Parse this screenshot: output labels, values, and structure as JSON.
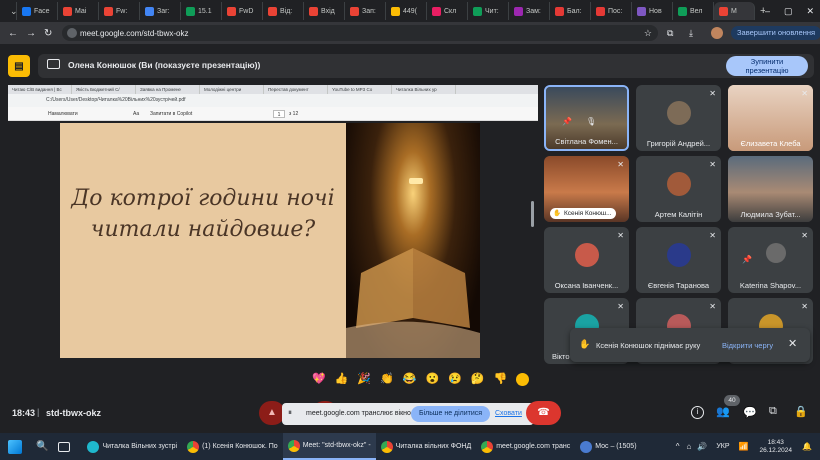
{
  "tabs": [
    {
      "label": "Face",
      "color": "#1877f2"
    },
    {
      "label": "Mai",
      "color": "#ea4335"
    },
    {
      "label": "Fw:",
      "color": "#ea4335"
    },
    {
      "label": "Заг:",
      "color": "#4285f4"
    },
    {
      "label": "15.1",
      "color": "#0f9d58"
    },
    {
      "label": "FwD",
      "color": "#ea4335"
    },
    {
      "label": "Від:",
      "color": "#ea4335"
    },
    {
      "label": "Вхід",
      "color": "#ea4335"
    },
    {
      "label": "Зап:",
      "color": "#ea4335"
    },
    {
      "label": "449(",
      "color": "#fbbc04"
    },
    {
      "label": "Скл",
      "color": "#e91e63"
    },
    {
      "label": "Чит:",
      "color": "#0f9d58"
    },
    {
      "label": "Зам:",
      "color": "#9c27b0"
    },
    {
      "label": "Бал:",
      "color": "#e53935"
    },
    {
      "label": "Пос:",
      "color": "#e53935"
    },
    {
      "label": "Нов",
      "color": "#7e57c2"
    },
    {
      "label": "Вел",
      "color": "#0f9d58"
    },
    {
      "label": "M",
      "color": "#ea4335"
    }
  ],
  "new_tab": "+",
  "window_controls": [
    "–",
    "▢",
    "✕"
  ],
  "address": "meet.google.com/std-tbwx-okz",
  "update_button": "Завершити оновлення",
  "meet": {
    "presenter_text": "Олена Конюшок (Ви (показуєте презентацію))",
    "stop_button_line1": "Зупинити",
    "stop_button_line2": "презентацію",
    "meeting_code": "std-tbwx-okz",
    "time": "18:43",
    "participants_count": "40"
  },
  "shared": {
    "tabs": [
      "Читаю С/В видання | Вс",
      "Якість Бюджетний С/",
      "Заявка на Промене",
      "Молодіжні центри",
      "Перестав документ",
      "YouTube to MP3 Co",
      "Читалка Вільних ур"
    ],
    "address": "C:/Users/User/Desktop/Читалка%20Вільних%20зустрічей.pdf",
    "pdf_toolbar": [
      "Намалювати",
      "Aa",
      "Запитати в Copilot"
    ],
    "page": "1",
    "page_total": "з 12",
    "slide_title": "До котрої години ночі читали найдовше?"
  },
  "tiles": [
    {
      "name": "Світлана Фомен...",
      "muted": false
    },
    {
      "name": "Григорій Андрей...",
      "muted": true
    },
    {
      "name": "Єлизавета Клеба",
      "muted": true
    },
    {
      "name": "Ксенія Конюш...",
      "muted": true
    },
    {
      "name": "Артем Калітін",
      "muted": true
    },
    {
      "name": "Людмила Зубат...",
      "muted": true
    },
    {
      "name": "Оксана Іванченк...",
      "muted": true
    },
    {
      "name": "Євгенія Таранова",
      "muted": true
    },
    {
      "name": "Katerina Shapov...",
      "muted": true
    },
    {
      "name": "Вікто",
      "muted": true
    }
  ],
  "hand_notice": {
    "text": "Ксенія Конюшок піднімає руку",
    "link": "Відкрити чергу"
  },
  "reactions": [
    "💖",
    "👍",
    "🎉",
    "👏",
    "😂",
    "😮",
    "😢",
    "🤔",
    "👎"
  ],
  "share_banner": {
    "text": "meet.google.com транслює вікно.",
    "stop": "Більше не ділитися",
    "hide": "Сховати"
  },
  "taskbar": {
    "items": [
      "Читалка Вільних зустрі",
      "(1) Ксенія Конюшок. По",
      "Meet: \"std-tbwx-okz\" -",
      "Читалка вільних ФОНД",
      "meet.google.com транс",
      "Мос – (1505)"
    ],
    "lang": "УКР",
    "time": "18:43",
    "date": "26.12.2024"
  }
}
